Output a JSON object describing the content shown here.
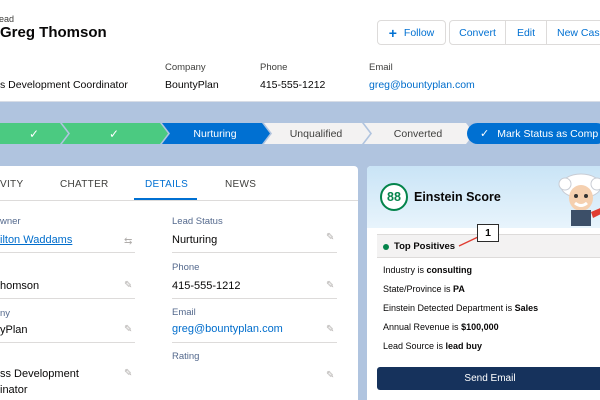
{
  "header": {
    "object_label": "ead",
    "record_name": "Greg Thomson",
    "buttons": {
      "follow": "Follow",
      "convert": "Convert",
      "edit": "Edit",
      "new_case": "New Case"
    },
    "highlights": [
      {
        "label": "",
        "value": "s Development Coordinator"
      },
      {
        "label": "Company",
        "value": "BountyPlan"
      },
      {
        "label": "Phone",
        "value": "415-555-1212"
      },
      {
        "label": "Email",
        "value": "greg@bountyplan.com"
      }
    ]
  },
  "path": {
    "steps": [
      {
        "label": "",
        "state": "complete"
      },
      {
        "label": "",
        "state": "complete"
      },
      {
        "label": "Nurturing",
        "state": "current"
      },
      {
        "label": "Unqualified",
        "state": "incomplete"
      },
      {
        "label": "Converted",
        "state": "incomplete"
      }
    ],
    "mark_status_label": "Mark Status as Comp",
    "colors": {
      "complete": "#4bca81",
      "current": "#0070d2",
      "incomplete": "#f3f2f2"
    }
  },
  "tabs": {
    "activity": "VITY",
    "chatter": "CHATTER",
    "details": "DETAILS",
    "news": "NEWS"
  },
  "details": {
    "owner_label": "wner",
    "owner_value": "ilton Waddams",
    "lead_status_label": "Lead Status",
    "lead_status_value": "Nurturing",
    "name_value": "homson",
    "phone_label": "Phone",
    "phone_value": "415-555-1212",
    "company_label": "ny",
    "company_value": "yPlan",
    "email_label": "Email",
    "email_value": "greg@bountyplan.com",
    "rating_label": "Rating",
    "title_value_line1": "ss Development",
    "title_value_line2": "inator"
  },
  "einstein": {
    "score": "88",
    "title": "Einstein Score",
    "positives_label": "Top Positives",
    "callout": "1",
    "insights": [
      {
        "prefix": "Industry is ",
        "value": "consulting"
      },
      {
        "prefix": "State/Province is ",
        "value": "PA"
      },
      {
        "prefix": "Einstein Detected Department is ",
        "value": "Sales"
      },
      {
        "prefix": "Annual Revenue is ",
        "value": "$100,000"
      },
      {
        "prefix": "Lead Source is ",
        "value": "lead buy"
      }
    ],
    "send_email": "Send Email"
  }
}
